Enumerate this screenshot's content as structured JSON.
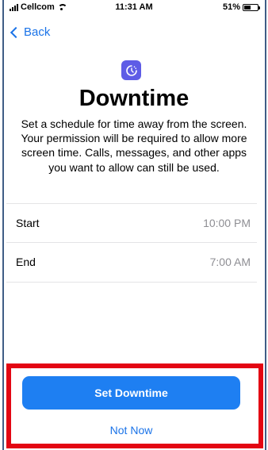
{
  "status_bar": {
    "carrier": "Cellcom",
    "time": "11:31 AM",
    "battery_percent": "51%",
    "battery_level": 0.51
  },
  "nav": {
    "back_label": "Back"
  },
  "header": {
    "icon": "downtime-clock-icon",
    "title": "Downtime",
    "description": "Set a schedule for time away from the screen. Your permission will be required to allow more screen time. Calls, messages, and other apps you want to allow can still be used."
  },
  "schedule": {
    "rows": [
      {
        "label": "Start",
        "value": "10:00 PM"
      },
      {
        "label": "End",
        "value": "7:00 AM"
      }
    ]
  },
  "actions": {
    "primary_label": "Set Downtime",
    "secondary_label": "Not Now"
  },
  "colors": {
    "accent": "#1e7ff2",
    "icon_bg": "#5e5ce6",
    "highlight": "#e30613"
  }
}
